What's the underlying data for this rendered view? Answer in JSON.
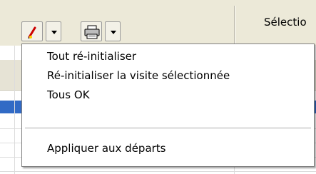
{
  "toolbar": {
    "header_text": "Sélectio",
    "reset_button_icon": "red-pen-icon",
    "print_button_icon": "printer-icon",
    "dropdown_icon": "chevron-down-icon"
  },
  "menu": {
    "items": [
      {
        "label": "Tout ré-initialiser"
      },
      {
        "label": "Ré-initialiser la visite sélectionnée"
      },
      {
        "label": "Tous OK"
      },
      {
        "label": "Appliquer aux départs"
      }
    ]
  },
  "colors": {
    "toolbar_bg": "#ece9d8",
    "selection": "#316ac5",
    "menu_bg": "#ffffff"
  }
}
